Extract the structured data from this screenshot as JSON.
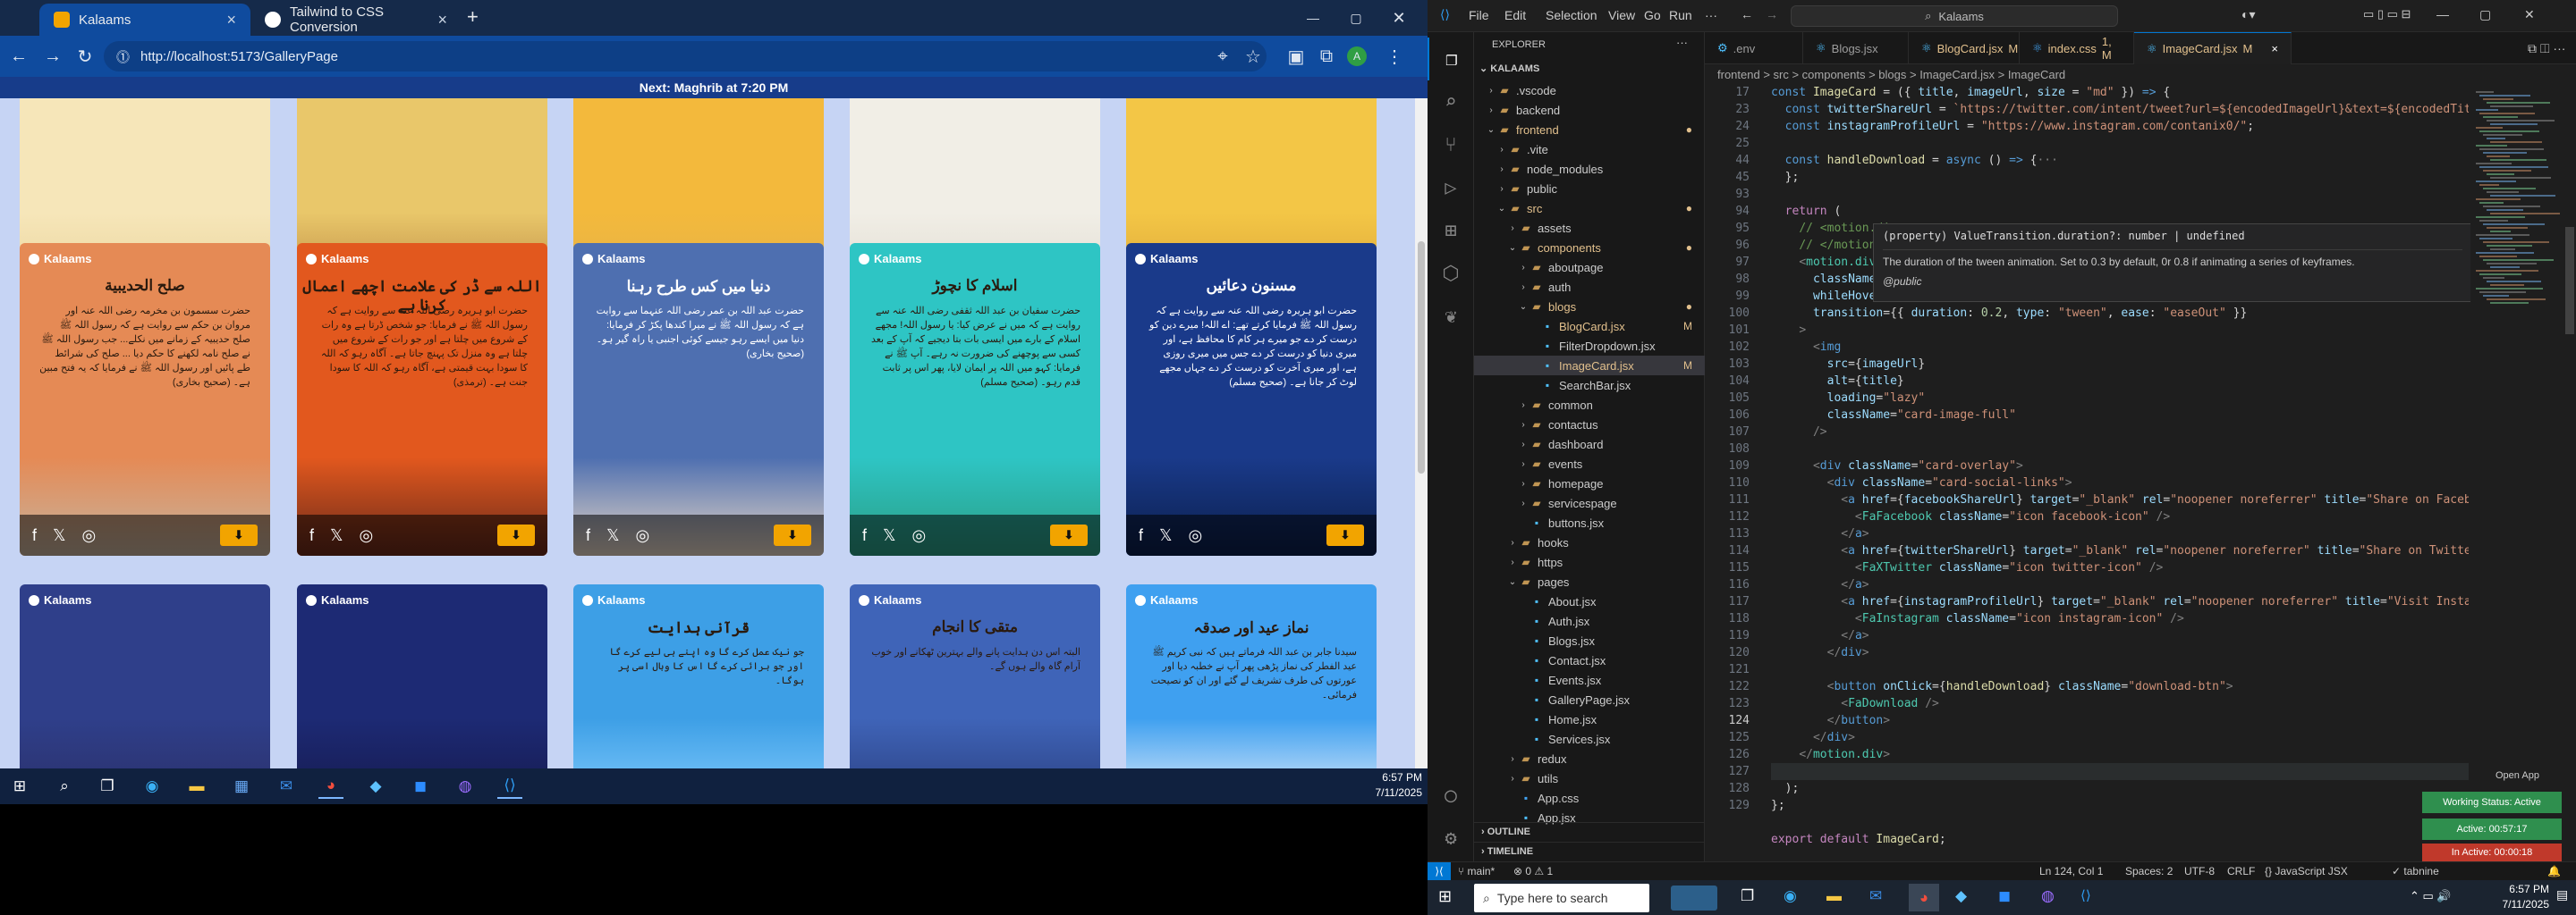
{
  "chrome": {
    "tabs": [
      {
        "title": "Kalaams",
        "active": true
      },
      {
        "title": "Tailwind to CSS Conversion",
        "active": false
      }
    ],
    "new_tab": "+",
    "url": "http://localhost:5173/GalleryPage",
    "banner": "Next: Maghrib at 7:20 PM"
  },
  "gallery": {
    "brand": "Kalaams",
    "row1_titles": [
      "",
      "",
      "",
      "",
      ""
    ],
    "row2": [
      {
        "title": "صلح الحديبية",
        "text": "حضرت سسمون بن مخرمہ رضی اللہ عنہ اور مروان بن حکم سے روایت ہے کہ رسول اللہ ﷺ صلح حدیبیہ کے زمانے میں نکلے... جب رسول اللہ ﷺ نے صلح نامہ لکھنے کا حکم دیا ... صلح کی شرائط طے پائیں اور رسول اللہ ﷺ نے فرمایا کہ یہ فتح مبین ہے۔ (صحیح بخاری)"
      },
      {
        "title": "اللہ سے ڈر کی علامت اچھے اعمال کرنا ہے",
        "text": "حضرت ابو ہریرہ رضی اللہ عنہ سے روایت ہے کہ رسول اللہ ﷺ نے فرمایا: جو شخص ڈرتا ہے وہ رات کے شروع میں چلتا ہے اور جو رات کے شروع میں چلتا ہے وہ منزل تک پہنچ جاتا ہے۔ آگاہ رہو کہ اللہ کا سودا بہت قیمتی ہے، آگاہ رہو کہ اللہ کا سودا جنت ہے۔ (ترمذی)"
      },
      {
        "title": "دنیا میں کس طرح رہنا",
        "text": "حضرت عبد اللہ بن عمر رضی اللہ عنہما سے روایت ہے کہ رسول اللہ ﷺ نے میرا کندھا پکڑ کر فرمایا: دنیا میں ایسے رہو جیسے کوئی اجنبی یا راہ گیر ہو۔ (صحیح بخاری)"
      },
      {
        "title": "اسلام کا نچوڑ",
        "text": "حضرت سفیان بن عبد اللہ ثقفی رضی اللہ عنہ سے روایت ہے کہ میں نے عرض کیا: یا رسول اللہ! مجھے اسلام کے بارے میں ایسی بات بتا دیجیے کہ آپ کے بعد کسی سے پوچھنے کی ضرورت نہ رہے۔ آپ ﷺ نے فرمایا: کہو میں اللہ پر ایمان لایا، پھر اس پر ثابت قدم رہو۔ (صحیح مسلم)"
      },
      {
        "title": "مسنون دعائیں",
        "text": "حضرت ابو ہریرہ رضی اللہ عنہ سے روایت ہے کہ رسول اللہ ﷺ فرمایا کرتے تھے: اے اللہ! میرے دین کو درست کر دے جو میرے ہر کام کا محافظ ہے، اور میری دنیا کو درست کر دے جس میں میری روزی ہے، اور میری آخرت کو درست کر دے جہاں مجھے لوٹ کر جانا ہے۔ (صحیح مسلم)"
      }
    ],
    "row3": [
      {
        "title": "",
        "text": ""
      },
      {
        "title": "",
        "text": ""
      },
      {
        "title": "قرآنی ہدایت",
        "text": "جو نیک عمل کرے گا وہ اپنے ہی لیے کرے گا اور جو برائی کرے گا اس کا وبال اسی پر ہوگا۔"
      },
      {
        "title": "متقی کا انجام",
        "text": "البتہ اس دن ہدایت پانے والے بہترین ٹھکانے اور خوب آرام گاہ والے ہوں گے۔"
      },
      {
        "title": "نماز عید اور صدقہ",
        "text": "سیدنا جابر بن عبد اللہ فرماتے ہیں کہ نبی کریم ﷺ عید الفطر کی نماز پڑھی پھر آپ نے خطبہ دیا اور عورتوں کی طرف تشریف لے گئے اور ان کو نصیحت فرمائی۔"
      }
    ]
  },
  "taskbar_left": {
    "time": "6:57 PM",
    "date": "7/11/2025"
  },
  "vscode": {
    "menu": [
      "File",
      "Edit",
      "Selection",
      "View",
      "Go",
      "Run",
      "···"
    ],
    "search": "Kalaams",
    "explorer_title": "EXPLORER",
    "project": "KALAAMS",
    "tree": [
      {
        "label": ".vscode",
        "type": "folder",
        "depth": 1,
        "open": false
      },
      {
        "label": "backend",
        "type": "folder",
        "depth": 1,
        "open": false
      },
      {
        "label": "frontend",
        "type": "folder",
        "depth": 1,
        "open": true,
        "mod": true
      },
      {
        "label": ".vite",
        "type": "folder",
        "depth": 2,
        "open": false
      },
      {
        "label": "node_modules",
        "type": "folder",
        "depth": 2,
        "open": false
      },
      {
        "label": "public",
        "type": "folder",
        "depth": 2,
        "open": false
      },
      {
        "label": "src",
        "type": "folder",
        "depth": 2,
        "open": true,
        "mod": true
      },
      {
        "label": "assets",
        "type": "folder",
        "depth": 3,
        "open": false
      },
      {
        "label": "components",
        "type": "folder",
        "depth": 3,
        "open": true,
        "mod": true
      },
      {
        "label": "aboutpage",
        "type": "folder",
        "depth": 4,
        "open": false
      },
      {
        "label": "auth",
        "type": "folder",
        "depth": 4,
        "open": false
      },
      {
        "label": "blogs",
        "type": "folder",
        "depth": 4,
        "open": true,
        "mod": true
      },
      {
        "label": "BlogCard.jsx",
        "type": "file",
        "depth": 5,
        "badge": "M"
      },
      {
        "label": "FilterDropdown.jsx",
        "type": "file",
        "depth": 5
      },
      {
        "label": "ImageCard.jsx",
        "type": "file",
        "depth": 5,
        "badge": "M",
        "selected": true
      },
      {
        "label": "SearchBar.jsx",
        "type": "file",
        "depth": 5
      },
      {
        "label": "common",
        "type": "folder",
        "depth": 4,
        "open": false
      },
      {
        "label": "contactus",
        "type": "folder",
        "depth": 4,
        "open": false
      },
      {
        "label": "dashboard",
        "type": "folder",
        "depth": 4,
        "open": false
      },
      {
        "label": "events",
        "type": "folder",
        "depth": 4,
        "open": false
      },
      {
        "label": "homepage",
        "type": "folder",
        "depth": 4,
        "open": false
      },
      {
        "label": "servicespage",
        "type": "folder",
        "depth": 4,
        "open": false
      },
      {
        "label": "buttons.jsx",
        "type": "file",
        "depth": 4
      },
      {
        "label": "hooks",
        "type": "folder",
        "depth": 3,
        "open": false
      },
      {
        "label": "https",
        "type": "folder",
        "depth": 3,
        "open": false
      },
      {
        "label": "pages",
        "type": "folder",
        "depth": 3,
        "open": true
      },
      {
        "label": "About.jsx",
        "type": "file",
        "depth": 4
      },
      {
        "label": "Auth.jsx",
        "type": "file",
        "depth": 4
      },
      {
        "label": "Blogs.jsx",
        "type": "file",
        "depth": 4
      },
      {
        "label": "Contact.jsx",
        "type": "file",
        "depth": 4
      },
      {
        "label": "Events.jsx",
        "type": "file",
        "depth": 4
      },
      {
        "label": "GalleryPage.jsx",
        "type": "file",
        "depth": 4
      },
      {
        "label": "Home.jsx",
        "type": "file",
        "depth": 4
      },
      {
        "label": "Services.jsx",
        "type": "file",
        "depth": 4
      },
      {
        "label": "redux",
        "type": "folder",
        "depth": 3,
        "open": false
      },
      {
        "label": "utils",
        "type": "folder",
        "depth": 3,
        "open": false
      },
      {
        "label": "App.css",
        "type": "file",
        "depth": 3
      },
      {
        "label": "App.jsx",
        "type": "file",
        "depth": 3
      }
    ],
    "outline": "OUTLINE",
    "timeline": "TIMELINE",
    "tabs": [
      {
        "label": ".env",
        "badge": ""
      },
      {
        "label": "Blogs.jsx",
        "badge": ""
      },
      {
        "label": "BlogCard.jsx",
        "badge": "M"
      },
      {
        "label": "index.css",
        "badge": "1, M"
      },
      {
        "label": "ImageCard.jsx",
        "badge": "M",
        "active": true
      }
    ],
    "breadcrumb": "frontend > src > components > blogs > ImageCard.jsx > ImageCard",
    "line_numbers": [
      "17",
      "23",
      "24",
      "25",
      "44",
      "45",
      "93",
      "94",
      "95",
      "96",
      "97",
      "98",
      "99",
      "100",
      "101",
      "102",
      "103",
      "104",
      "105",
      "106",
      "107",
      "108",
      "109",
      "110",
      "111",
      "112",
      "113",
      "114",
      "115",
      "116",
      "117",
      "118",
      "119",
      "120",
      "121",
      "122",
      "123",
      "124",
      "125",
      "126",
      "127",
      "128",
      "129"
    ],
    "hover": {
      "signature": "(property) ValueTransition.duration?: number | undefined",
      "doc": "The duration of the tween animation. Set to 0.3 by default, 0r 0.8 if animating a series of keyframes.",
      "tag": "@public"
    },
    "status": {
      "branch": "main*",
      "errors": "0",
      "warnings": "1",
      "position": "Ln 124, Col 1",
      "spaces": "Spaces: 2",
      "encoding": "UTF-8",
      "eol": "CRLF",
      "language": "JavaScript JSX",
      "extra": "tabnine",
      "open_app": "Open App"
    },
    "work": {
      "status": "Working Status: Active",
      "active": "Active: 00:57:17",
      "inactive": "In Active: 00:00:18"
    }
  },
  "taskbar_right": {
    "search_placeholder": "Type here to search",
    "time": "6:57 PM",
    "date": "7/11/2025"
  }
}
